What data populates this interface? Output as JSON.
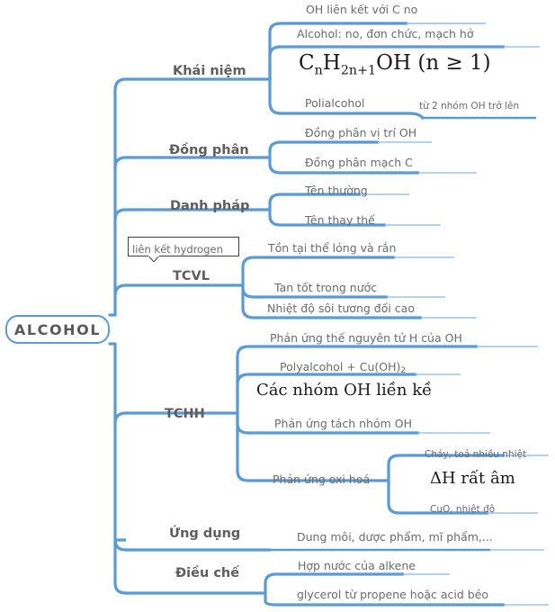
{
  "diagram": {
    "type": "mind-map",
    "title": "ALCOHOL",
    "accent_color": "#5B9BD5",
    "label_color": "#5e5e5e",
    "leaf_color": "#6b6b6b"
  },
  "root": {
    "label": "ALCOHOL"
  },
  "branches": [
    {
      "label": "Khái niệm",
      "leaves": [
        {
          "text": "OH liên kết với C no"
        },
        {
          "text": "Alcohol: no, đơn chức, mạch hở"
        },
        {
          "text": "Polialcohol"
        }
      ],
      "formula": {
        "c": "C",
        "n": "n",
        "h": "H",
        "h_sub": "2n+1",
        "oh": "OH",
        "cond": " (n ≥ 1)"
      },
      "sub_note": "từ 2 nhóm OH trở lên"
    },
    {
      "label": "Đồng phân",
      "leaves": [
        {
          "text": "Đồng phân vị trí OH"
        },
        {
          "text": "Đồng phân mạch C"
        }
      ]
    },
    {
      "label": "Danh pháp",
      "leaves": [
        {
          "text": "Tên thường"
        },
        {
          "text": "Tên thay thế"
        }
      ]
    },
    {
      "label": "TCVL",
      "callout": "liên kết hydrogen",
      "leaves": [
        {
          "text": "Tồn tại thể lỏng và rắn"
        },
        {
          "text": "Tan tốt trong nước"
        },
        {
          "text": "Nhiệt độ sôi tương đối cao"
        }
      ]
    },
    {
      "label": "TCHH",
      "leaves": [
        {
          "text": "Phản ứng thế nguyên tử H của OH"
        },
        {
          "text": "Polyalcohol + Cu(OH)"
        },
        {
          "text": "Phản ứng tách nhóm OH"
        },
        {
          "text": "Phản ứng oxi hoá"
        }
      ],
      "cu_sub": "2",
      "highlight": "Các nhóm OH liền kề",
      "oxi": {
        "top": "Cháy, toả nhiều nhiệt",
        "mid": "ΔH rất âm",
        "bottom": "CuO, nhiệt độ"
      }
    },
    {
      "label": "Ứng dụng",
      "leaves": [
        {
          "text": "Dung môi, dược phẩm, mĩ phẩm,..."
        }
      ]
    },
    {
      "label": "Điều chế",
      "leaves": [
        {
          "text": "Hợp nước của alkene"
        },
        {
          "text": "glycerol từ propene hoặc acid béo"
        }
      ]
    }
  ]
}
